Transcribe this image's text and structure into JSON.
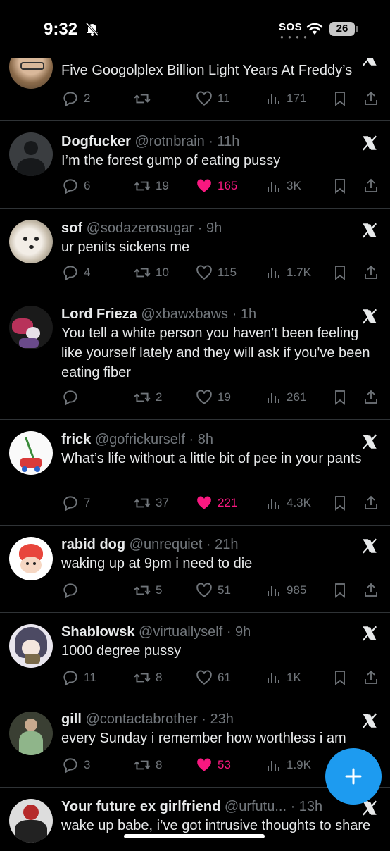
{
  "status": {
    "time": "9:32",
    "sos": "SOS",
    "battery": "26"
  },
  "tweets": [
    {
      "name": "",
      "handle": "",
      "body": "Five Googolplex Billion Light Years At Freddy’s",
      "replies": "2",
      "retweets": "",
      "likes": "11",
      "views": "171",
      "liked": false
    },
    {
      "name": "Dogfucker",
      "handle": "@rotnbrain · 11h",
      "body": "I’m the forest gump of eating pussy",
      "replies": "6",
      "retweets": "19",
      "likes": "165",
      "views": "3K",
      "liked": true
    },
    {
      "name": "sof",
      "handle": "@sodazerosugar · 9h",
      "body": "ur penits sickens me",
      "replies": "4",
      "retweets": "10",
      "likes": "115",
      "views": "1.7K",
      "liked": false
    },
    {
      "name": "Lord Frieza",
      "handle": "@xbawxbaws · 1h",
      "body": "You tell a white person you haven't been feeling like yourself lately and they will ask if you've been eating fiber",
      "replies": "",
      "retweets": "2",
      "likes": "19",
      "views": "261",
      "liked": false
    },
    {
      "name": "frick",
      "handle": "@gofrickurself · 8h",
      "body": "What’s life without a little bit of pee in your pants",
      "replies": "7",
      "retweets": "37",
      "likes": "221",
      "views": "4.3K",
      "liked": true
    },
    {
      "name": "rabid dog",
      "handle": "@unrequiet · 21h",
      "body": "waking up at 9pm i need to die",
      "replies": "",
      "retweets": "5",
      "likes": "51",
      "views": "985",
      "liked": false
    },
    {
      "name": "Shablowsk",
      "handle": "@virtuallyself · 9h",
      "body": "1000 degree pussy",
      "replies": "11",
      "retweets": "8",
      "likes": "61",
      "views": "1K",
      "liked": false
    },
    {
      "name": "gill",
      "handle": "@contactabrother · 23h",
      "body": "every Sunday i remember how worthless i am",
      "replies": "3",
      "retweets": "8",
      "likes": "53",
      "views": "1.9K",
      "liked": true
    },
    {
      "name": "Your future ex girlfriend",
      "handle": "@urfutu... · 13h",
      "body": "wake up babe, i’ve got intrusive thoughts to share",
      "replies": "",
      "retweets": "",
      "likes": "",
      "views": "",
      "liked": false
    }
  ]
}
